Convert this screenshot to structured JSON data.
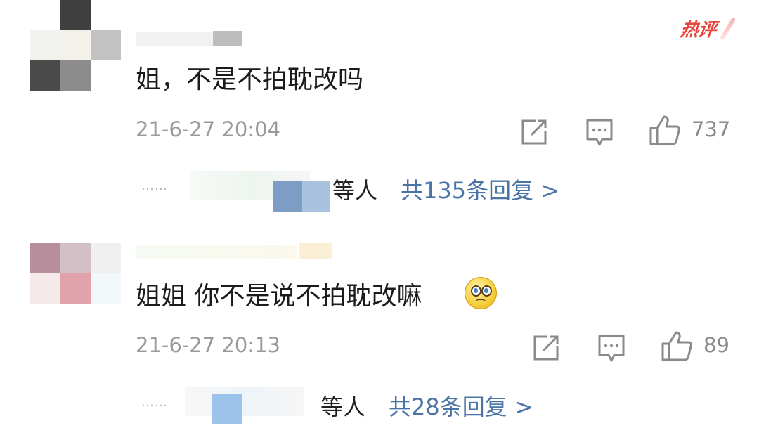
{
  "badge": {
    "hot": "热评"
  },
  "comments": [
    {
      "text": "姐，不是不拍耽改吗",
      "timestamp": "21-6-27 20:04",
      "likes": "737",
      "reply_dots": "……",
      "reply_people": "等人",
      "reply_link": "共135条回复 >"
    },
    {
      "text": "姐姐 你不是说不拍耽改嘛",
      "timestamp": "21-6-27 20:13",
      "likes": "89",
      "reply_dots": "……",
      "reply_people": "等人",
      "reply_link": "共28条回复 >"
    }
  ],
  "icons": {
    "share": "share-icon",
    "comment": "comment-icon",
    "like": "thumbs-up-icon",
    "emoji": "teary-face-emoji"
  },
  "colors": {
    "link": "#4a73a6",
    "hot_badge": "#e8453c",
    "meta_gray": "#9a9a9a"
  }
}
